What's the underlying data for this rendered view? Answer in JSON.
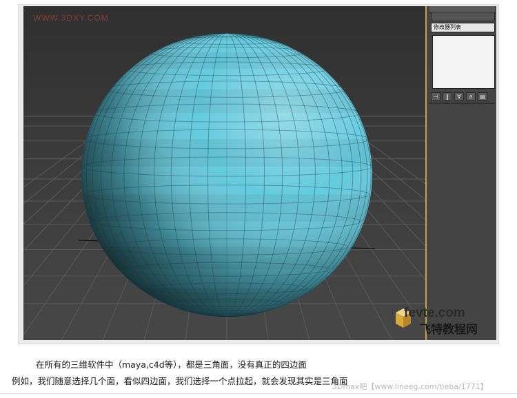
{
  "viewport": {
    "watermark": "WWW.3DXY.COM",
    "bg_color": "#3a3a3a",
    "sphere_color": "#5ec8dc",
    "grid_color": "#5a5a5a"
  },
  "command_panel": {
    "modifier_list": "修改器列表",
    "border_color": "#c9a43a",
    "tools": [
      {
        "glyph": "⊣"
      },
      {
        "glyph": "‖"
      },
      {
        "glyph": "∀"
      },
      {
        "glyph": "∂"
      },
      {
        "glyph": "▤"
      }
    ]
  },
  "brand": {
    "url_text": "fevte.com",
    "name_text": "飞特教程网"
  },
  "article": {
    "line1": "在所有的三维软件中（maya,c4d等），都是三角面，没有真正的四边面",
    "line2": "例如，我们随意选择几个面，看似四边面，我们选择一个点拉起，就会发现其实是三角面",
    "source": "3Dmax吧【www.lineeg.com/tieba/1771】"
  }
}
